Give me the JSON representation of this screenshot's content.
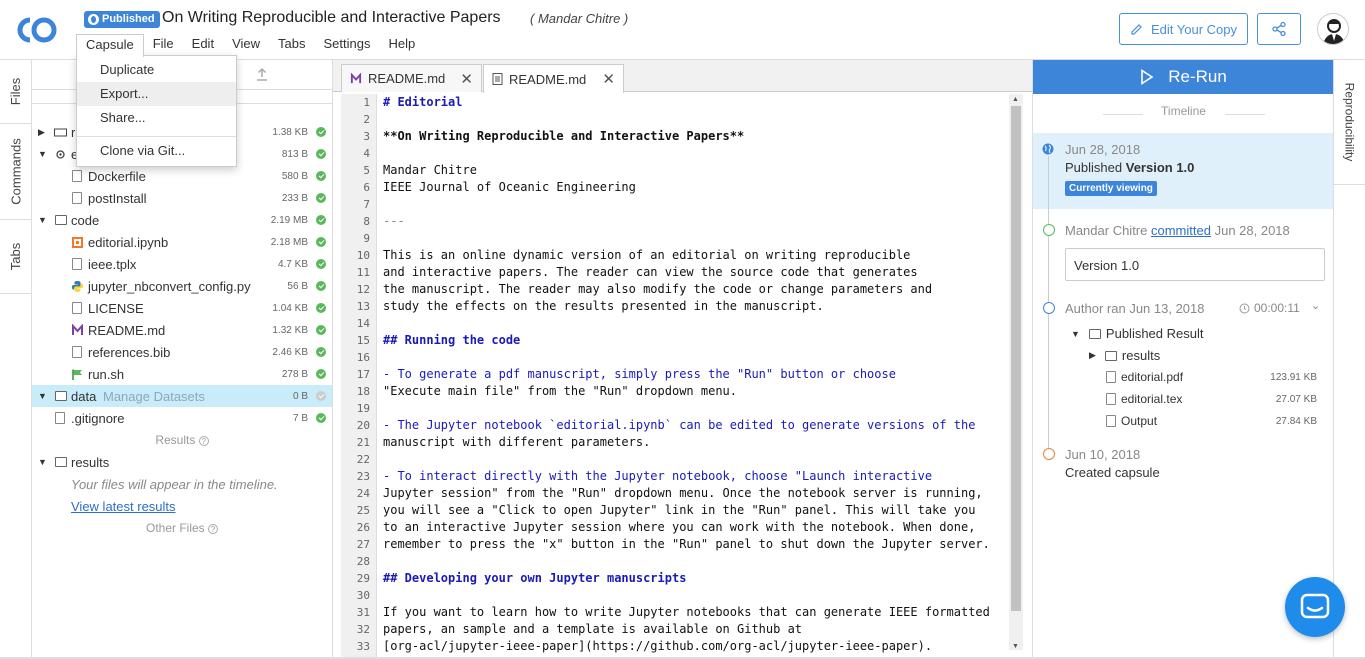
{
  "header": {
    "badge": "Published",
    "title": "On Writing Reproducible and Interactive Papers",
    "author": "( Mandar Chitre )",
    "edit_copy": "Edit Your Copy"
  },
  "menubar": [
    "Capsule",
    "File",
    "Edit",
    "View",
    "Tabs",
    "Settings",
    "Help"
  ],
  "dropdown": [
    "Duplicate",
    "Export...",
    "Share...",
    "Clone via Git..."
  ],
  "left_tabs": [
    "Files",
    "Commands",
    "Tabs"
  ],
  "files": {
    "rows": [
      {
        "name": "r",
        "size": "1.38 KB"
      },
      {
        "name": "e",
        "size": "813 B"
      },
      {
        "name": "Dockerfile",
        "size": "580 B"
      },
      {
        "name": "postInstall",
        "size": "233 B"
      },
      {
        "name": "code",
        "size": "2.19 MB"
      },
      {
        "name": "editorial.ipynb",
        "size": "2.18 MB"
      },
      {
        "name": "ieee.tplx",
        "size": "4.7 KB"
      },
      {
        "name": "jupyter_nbconvert_config.py",
        "size": "56 B"
      },
      {
        "name": "LICENSE",
        "size": "1.04 KB"
      },
      {
        "name": "README.md",
        "size": "1.32 KB"
      },
      {
        "name": "references.bib",
        "size": "2.46 KB"
      },
      {
        "name": "run.sh",
        "size": "278 B"
      },
      {
        "name": "data",
        "size": "0 B"
      },
      {
        "name": ".gitignore",
        "size": "7 B"
      }
    ],
    "manage_datasets": "Manage Datasets",
    "results_section": "Results",
    "results_folder": "results",
    "results_hint": "Your files will appear in the timeline.",
    "view_latest": "View latest results",
    "other_files": "Other Files"
  },
  "editor": {
    "tabs": [
      "README.md",
      "README.md"
    ],
    "lines": [
      "# Editorial",
      "",
      "**On Writing Reproducible and Interactive Papers**",
      "",
      "Mandar Chitre",
      "IEEE Journal of Oceanic Engineering",
      "",
      "---",
      "",
      "This is an online dynamic version of an editorial on writing reproducible",
      "and interactive papers. The reader can view the source code that generates",
      "the manuscript. The reader may also modify the code or change parameters and",
      "study the effects on the results presented in the manuscript.",
      "",
      "## Running the code",
      "",
      "- To generate a pdf manuscript, simply press the \"Run\" button or choose",
      "\"Execute main file\" from the \"Run\" dropdown menu.",
      "",
      "- The Jupyter notebook `editorial.ipynb` can be edited to generate versions of the",
      "manuscript with different parameters.",
      "",
      "- To interact directly with the Jupyter notebook, choose \"Launch interactive",
      "Jupyter session\" from the \"Run\" dropdown menu. Once the notebook server is running,",
      "you will see a \"Click to open Jupyter\" link in the \"Run\" panel. This will take you",
      "to an interactive Jupyter session where you can work with the notebook. When done,",
      "remember to press the \"x\" button in the \"Run\" panel to shut down the Jupyter server.",
      "",
      "## Developing your own Jupyter manuscripts",
      "",
      "If you want to learn how to write Jupyter notebooks that can generate IEEE formatted",
      "papers, an sample and a template is available on Github at",
      "[org-acl/jupyter-ieee-paper](https://github.com/org-acl/jupyter-ieee-paper)."
    ]
  },
  "timeline": {
    "rerun": "Re-Run",
    "label": "Timeline",
    "v1_date": "Jun 28, 2018",
    "v1_text": "Published",
    "v1_version": "Version 1.0",
    "currently_viewing": "Currently viewing",
    "commit_author": "Mandar Chitre",
    "commit_link": "committed",
    "commit_date": "Jun 28, 2018",
    "commit_msg": "Version 1.0",
    "run_text": "Author ran Jun 13, 2018",
    "run_duration": "00:00:11",
    "published_result": "Published Result",
    "results": "results",
    "result_files": [
      {
        "name": "editorial.pdf",
        "size": "123.91 KB"
      },
      {
        "name": "editorial.tex",
        "size": "27.07 KB"
      },
      {
        "name": "Output",
        "size": "27.84 KB"
      }
    ],
    "created_date": "Jun 10, 2018",
    "created_text": "Created capsule"
  },
  "right_tab": "Reproducibility"
}
